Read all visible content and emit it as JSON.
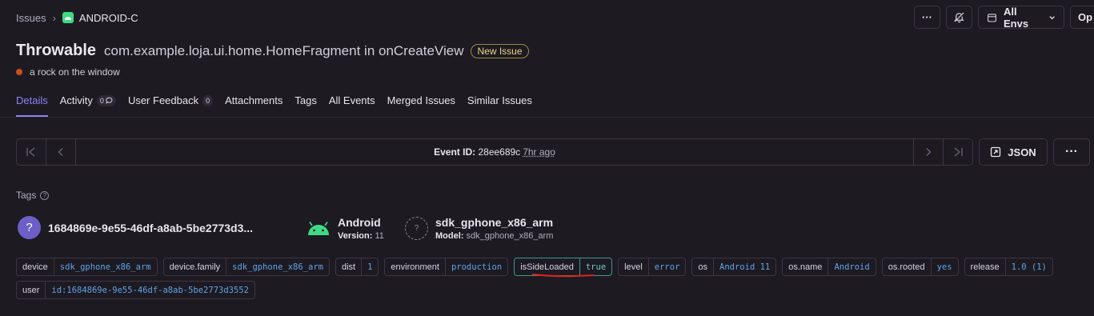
{
  "breadcrumb": {
    "issues": "Issues",
    "project": "ANDROID-C"
  },
  "top_actions": {
    "more": "···",
    "env_label": "All Envs",
    "open_label": "Op"
  },
  "issue": {
    "type": "Throwable",
    "location": "com.example.loja.ui.home.HomeFragment in onCreateView",
    "status_badge": "New Issue",
    "culprit": "a rock on the window"
  },
  "tabs": [
    {
      "label": "Details"
    },
    {
      "label": "Activity",
      "count": "0"
    },
    {
      "label": "User Feedback",
      "count": "0"
    },
    {
      "label": "Attachments"
    },
    {
      "label": "Tags"
    },
    {
      "label": "All Events"
    },
    {
      "label": "Merged Issues"
    },
    {
      "label": "Similar Issues"
    }
  ],
  "event": {
    "label": "Event ID:",
    "id": "28ee689c",
    "ago": "7hr ago"
  },
  "json_label": "JSON",
  "tags_heading": "Tags",
  "context": {
    "user": {
      "icon": "?",
      "title": "1684869e-9e55-46df-a8ab-5be2773d3..."
    },
    "os": {
      "title": "Android",
      "sub_key": "Version:",
      "sub_value": "11"
    },
    "device": {
      "icon": "?",
      "title": "sdk_gphone_x86_arm",
      "sub_key": "Model:",
      "sub_value": "sdk_gphone_x86_arm"
    }
  },
  "tags": [
    {
      "key": "device",
      "value": "sdk_gphone_x86_arm"
    },
    {
      "key": "device.family",
      "value": "sdk_gphone_x86_arm"
    },
    {
      "key": "dist",
      "value": "1"
    },
    {
      "key": "environment",
      "value": "production"
    },
    {
      "key": "isSideLoaded",
      "value": "true"
    },
    {
      "key": "level",
      "value": "error"
    },
    {
      "key": "os",
      "value": "Android 11"
    },
    {
      "key": "os.name",
      "value": "Android"
    },
    {
      "key": "os.rooted",
      "value": "yes"
    },
    {
      "key": "release",
      "value": "1.0 (1)"
    },
    {
      "key": "user",
      "value": "id:1684869e-9e55-46df-a8ab-5be2773d3552"
    }
  ],
  "colors": {
    "accent": "#8d82f5",
    "tag_value": "#5fa4e8",
    "highlight": "#3a9b8a",
    "annotation": "#e0241b"
  }
}
